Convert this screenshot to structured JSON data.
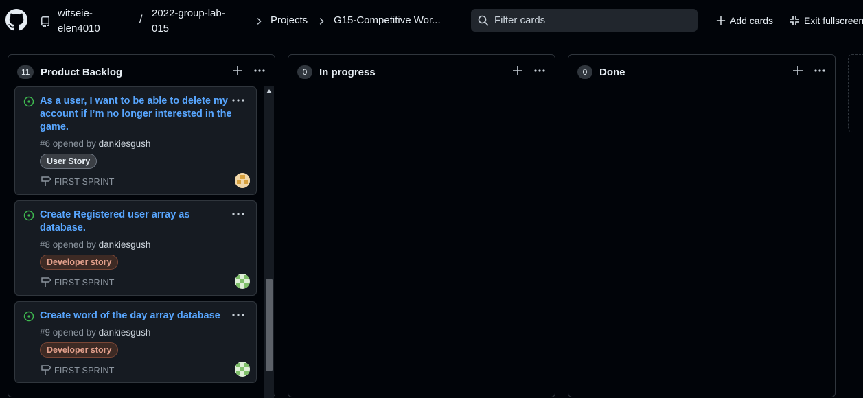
{
  "header": {
    "owner": "witseie-elen4010",
    "repo": "2022-group-lab-015",
    "crumbs": [
      "Projects",
      "G15-Competitive Wor..."
    ],
    "filter_placeholder": "Filter cards",
    "add_cards_label": "Add cards",
    "exit_fullscreen_label": "Exit fullscreen"
  },
  "columns": [
    {
      "count": "11",
      "title": "Product Backlog",
      "cards": [
        {
          "title": "As a user, I want to be able to delete my account if I’m no longer interested in the game.",
          "number": "#6",
          "opened_by_text": "opened by",
          "user": "dankiesgush",
          "label": "User Story",
          "milestone": "FIRST SPRINT",
          "avatar": "avatar-yellow"
        },
        {
          "title": "Create Registered user array as database.",
          "number": "#8",
          "opened_by_text": "opened by",
          "user": "dankiesgush",
          "label": "Developer story",
          "milestone": "FIRST SPRINT",
          "avatar": "avatar-green"
        },
        {
          "title": "Create word of the day array database",
          "number": "#9",
          "opened_by_text": "opened by",
          "user": "dankiesgush",
          "label": "Developer story",
          "milestone": "FIRST SPRINT",
          "avatar": "avatar-green"
        }
      ]
    },
    {
      "count": "0",
      "title": "In progress",
      "cards": []
    },
    {
      "count": "0",
      "title": "Done",
      "cards": []
    }
  ],
  "colors": {
    "background": "#010409",
    "card": "#161b22",
    "link": "#58a6ff",
    "open_status": "#3fb950",
    "border": "#30363d"
  }
}
